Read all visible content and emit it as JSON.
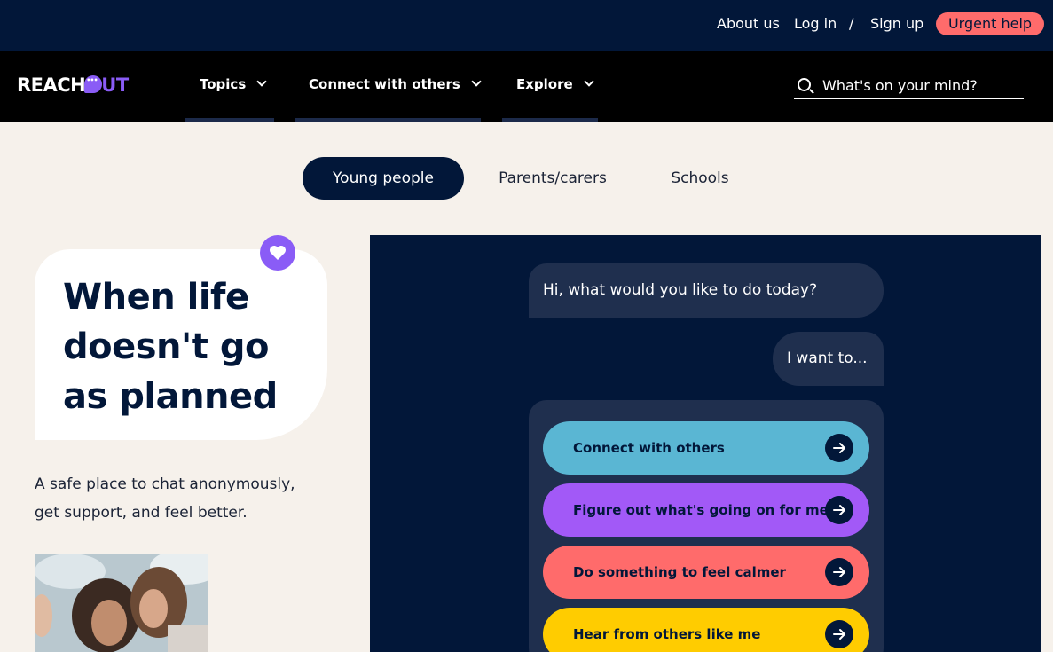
{
  "topbar": {
    "about": "About us",
    "login": "Log in",
    "separator": "/",
    "signup": "Sign up",
    "urgent": "Urgent help"
  },
  "nav": {
    "logo_reach": "REACH",
    "logo_out": "UT",
    "items": [
      {
        "label": "Topics"
      },
      {
        "label": "Connect with others"
      },
      {
        "label": "Explore"
      }
    ],
    "search_placeholder": "What's on your mind?"
  },
  "tabs": [
    {
      "label": "Young people",
      "active": true
    },
    {
      "label": "Parents/carers",
      "active": false
    },
    {
      "label": "Schools",
      "active": false
    }
  ],
  "hero": {
    "title": "When life doesn't go as planned",
    "tagline": "A safe place to chat anonymously, get support, and feel better."
  },
  "chat": {
    "bot_message": "Hi, what would you like to do today?",
    "user_message": "I want to...",
    "options": [
      {
        "label": "Connect with others",
        "color": "#5ab6d3"
      },
      {
        "label": "Figure out what's going on for me",
        "color": "#a259f7"
      },
      {
        "label": "Do something to feel calmer",
        "color": "#ff6b6b"
      },
      {
        "label": "Hear from others like me",
        "color": "#ffcc00"
      }
    ]
  },
  "colors": {
    "top_bar": "#021739",
    "nav_bar": "#000000",
    "page_bg": "#f6f1eb",
    "accent_purple": "#8a5cf6",
    "urgent": "#ff6b6b"
  }
}
